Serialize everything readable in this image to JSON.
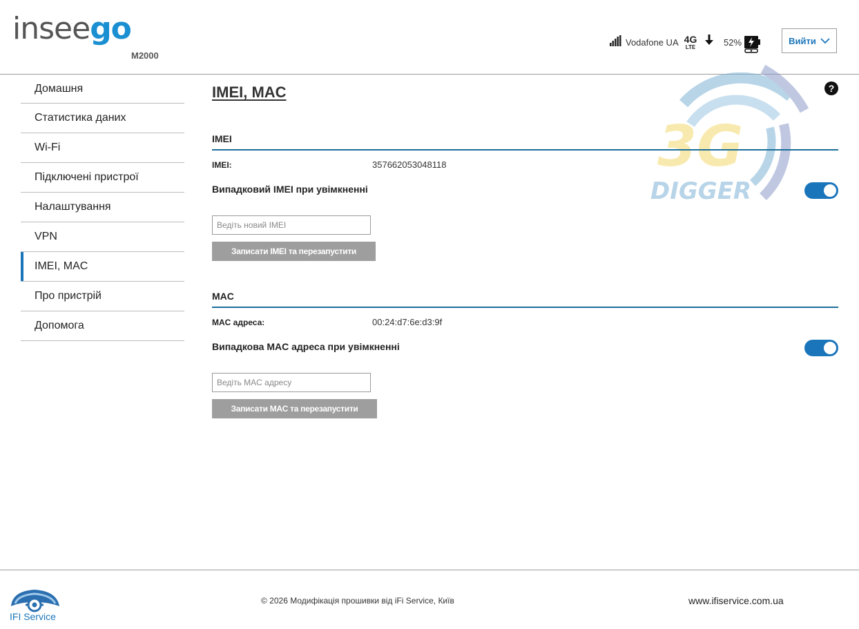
{
  "header": {
    "logo_part1": "insee",
    "logo_part2": "go",
    "model": "M2000",
    "carrier": "Vodafone UA",
    "network_type": "4G",
    "network_sub": "LTE",
    "battery": "52%",
    "logout_label": "Вийти"
  },
  "sidebar": {
    "items": [
      {
        "label": "Домашня"
      },
      {
        "label": "Статистика даних"
      },
      {
        "label": "Wi-Fi"
      },
      {
        "label": "Підключені пристрої"
      },
      {
        "label": "Налаштування"
      },
      {
        "label": "VPN"
      },
      {
        "label": "IMEI, MAC",
        "active": true
      },
      {
        "label": "Про пристрій"
      },
      {
        "label": "Допомога"
      }
    ]
  },
  "main": {
    "title": "IMEI, MAC",
    "help": "?",
    "imei_section": {
      "title": "IMEI",
      "label": "IMEI:",
      "value": "357662053048118",
      "toggle_label": "Випадковий IMEI при увімкненні",
      "toggle_on": true,
      "input_placeholder": "Ведіть новий IMEI",
      "button_label": "Записати IMEI та перезапустити"
    },
    "mac_section": {
      "title": "MAC",
      "label": "MAC адреса:",
      "value": "00:24:d7:6e:d3:9f",
      "toggle_label": "Випадкова MAC адреса при увімкненні",
      "toggle_on": true,
      "input_placeholder": "Ведіть MAC адресу",
      "button_label": "Записати MAC та перезапустити"
    }
  },
  "watermark": {
    "line1": "3G",
    "line2": "DIGGER"
  },
  "footer": {
    "brand": "IFI Service",
    "copyright": "© 2026 Модифікація прошивки від iFi Service, Київ",
    "website": "www.ifiservice.com.ua"
  },
  "colors": {
    "accent": "#1a75bb",
    "logo_blue": "#1a8fd1",
    "section_rule": "#1a6e9a",
    "button_gray": "#9e9e9e"
  }
}
